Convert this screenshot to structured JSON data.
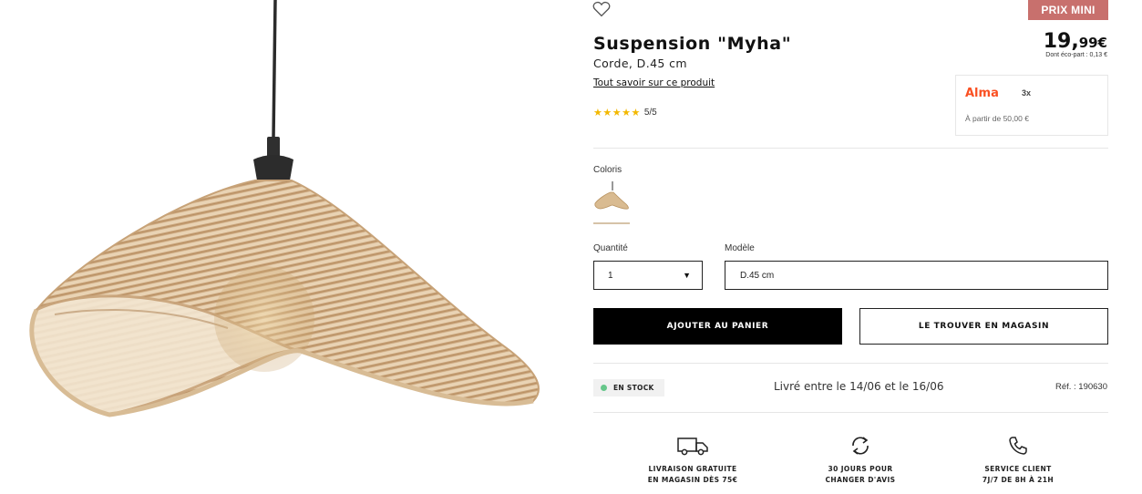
{
  "product": {
    "title": "Suspension \"Myha\"",
    "subtitle": "Corde, D.45 cm",
    "more_link": "Tout savoir sur ce produit",
    "rating_stars": "★★★★★",
    "rating_score": "5/5",
    "image_icon": "pendant-lamp-image"
  },
  "badge": {
    "label": "PRIX MINI",
    "color": "#c8706d"
  },
  "price": {
    "integer": "19,",
    "decimal": "99€",
    "eco_part": "Dont éco-part : 0,13 €"
  },
  "alma": {
    "logo": "Alma",
    "installments": "3x",
    "from": "À partir de 50,00 €",
    "color": "#fa5022"
  },
  "options": {
    "coloris_label": "Coloris",
    "quantity_label": "Quantité",
    "quantity_value": "1",
    "model_label": "Modèle",
    "model_value": "D.45 cm"
  },
  "actions": {
    "add_to_cart": "AJOUTER AU PANIER",
    "find_in_store": "LE TROUVER EN MAGASIN"
  },
  "availability": {
    "stock_label": "EN STOCK",
    "stock_color": "#66c78a",
    "delivery_text": "Livré entre le 14/06 et le 16/06",
    "reference": "Réf. : 190630"
  },
  "reassurance": [
    {
      "icon": "truck-icon",
      "line1": "LIVRAISON GRATUITE",
      "line2": "EN MAGASIN DÈS 75€"
    },
    {
      "icon": "refresh-icon",
      "line1": "30 JOURS POUR",
      "line2": "CHANGER D'AVIS"
    },
    {
      "icon": "phone-icon",
      "line1": "SERVICE CLIENT",
      "line2": "7J/7 DE 8H À 21H"
    }
  ]
}
